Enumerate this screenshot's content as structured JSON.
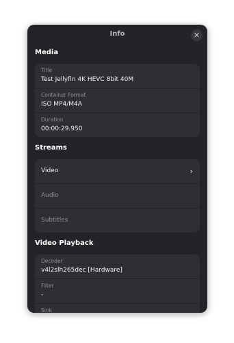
{
  "dialog": {
    "title": "Info"
  },
  "media": {
    "heading": "Media",
    "rows": [
      {
        "label": "Title",
        "value": "Test Jellyfin 4K HEVC 8bit 40M"
      },
      {
        "label": "Container Format",
        "value": "ISO MP4/M4A"
      },
      {
        "label": "Duration",
        "value": "00:00:29.950"
      }
    ]
  },
  "streams": {
    "heading": "Streams",
    "items": [
      {
        "label": "Video"
      },
      {
        "label": "Audio"
      },
      {
        "label": "Subtitles"
      }
    ]
  },
  "video_playback": {
    "heading": "Video Playback",
    "rows": [
      {
        "label": "Decoder",
        "value": "v4l2slh265dec [Hardware]"
      },
      {
        "label": "Filter",
        "value": "-"
      },
      {
        "label": "Sink",
        "value": ""
      }
    ]
  },
  "icons": {
    "close": "close-icon",
    "chevron": "chevron-right-icon"
  },
  "colors": {
    "background": "#242428",
    "card": "#2e2e33",
    "text": "#f2f2f2",
    "muted": "#8e8e93"
  }
}
